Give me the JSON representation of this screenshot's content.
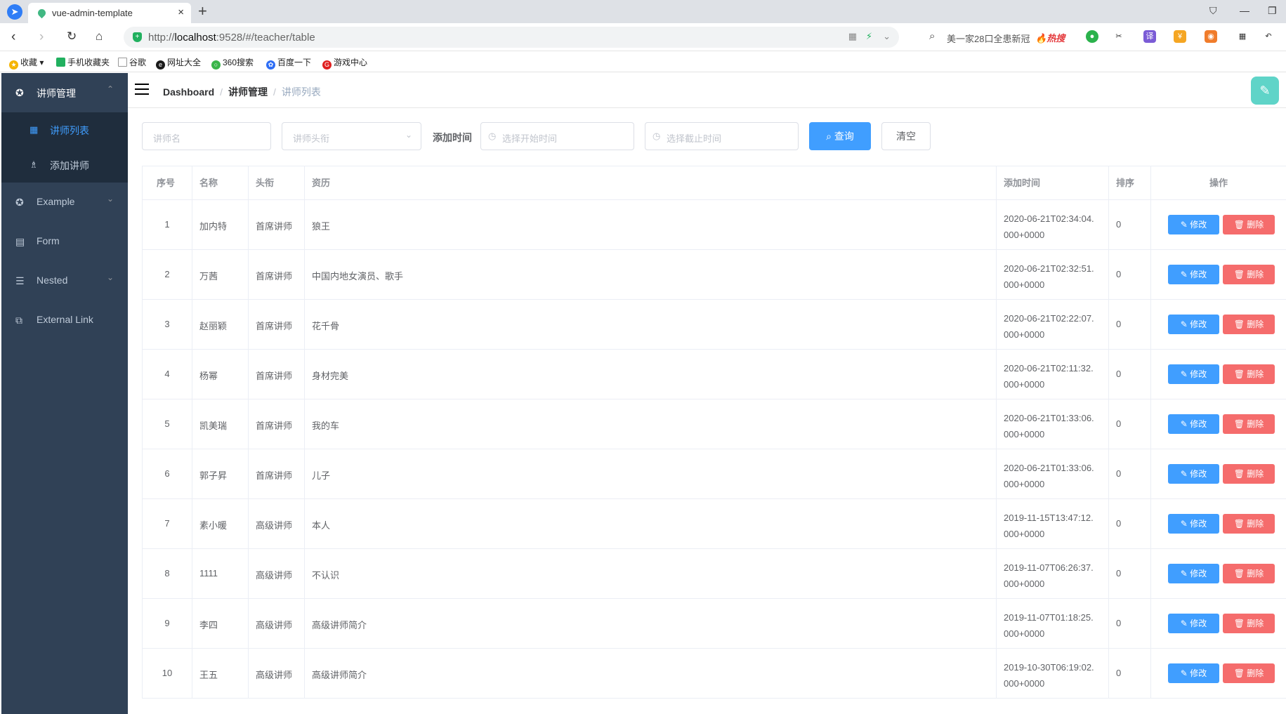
{
  "browser": {
    "tab_title": "vue-admin-template",
    "url_prefix": "http://",
    "url_host": "localhost",
    "url_rest": ":9528/#/teacher/table",
    "search_text": "美一家28口全患新冠",
    "hot_label": "热搜",
    "bookmarks": [
      "收藏",
      "手机收藏夹",
      "谷歌",
      "网址大全",
      "360搜索",
      "百度一下",
      "游戏中心"
    ]
  },
  "sidebar": {
    "group_label": "讲师管理",
    "sub_items": [
      "讲师列表",
      "添加讲师"
    ],
    "items": [
      "Example",
      "Form",
      "Nested",
      "External Link"
    ]
  },
  "navbar": {
    "breadcrumb": [
      "Dashboard",
      "讲师管理",
      "讲师列表"
    ]
  },
  "filter": {
    "name_placeholder": "讲师名",
    "level_placeholder": "讲师头衔",
    "time_label": "添加时间",
    "start_placeholder": "选择开始时间",
    "end_placeholder": "选择截止时间",
    "query_label": "查询",
    "clear_label": "清空"
  },
  "table": {
    "headers": [
      "序号",
      "名称",
      "头衔",
      "资历",
      "添加时间",
      "排序",
      "操作"
    ],
    "edit_label": "修改",
    "delete_label": "删除",
    "rows": [
      {
        "index": "1",
        "name": "加内特",
        "level": "首席讲师",
        "intro": "狼王",
        "time1": "2020-06-21T02:34:04.",
        "time2": "000+0000",
        "sort": "0"
      },
      {
        "index": "2",
        "name": "万茜",
        "level": "首席讲师",
        "intro": "中国内地女演员、歌手",
        "time1": "2020-06-21T02:32:51.",
        "time2": "000+0000",
        "sort": "0"
      },
      {
        "index": "3",
        "name": "赵丽颖",
        "level": "首席讲师",
        "intro": "花千骨",
        "time1": "2020-06-21T02:22:07.",
        "time2": "000+0000",
        "sort": "0"
      },
      {
        "index": "4",
        "name": "杨幂",
        "level": "首席讲师",
        "intro": "身材完美",
        "time1": "2020-06-21T02:11:32.",
        "time2": "000+0000",
        "sort": "0"
      },
      {
        "index": "5",
        "name": "凯美瑞",
        "level": "首席讲师",
        "intro": "我的车",
        "time1": "2020-06-21T01:33:06.",
        "time2": "000+0000",
        "sort": "0"
      },
      {
        "index": "6",
        "name": "郭子昇",
        "level": "首席讲师",
        "intro": "儿子",
        "time1": "2020-06-21T01:33:06.",
        "time2": "000+0000",
        "sort": "0"
      },
      {
        "index": "7",
        "name": "素小暖",
        "level": "高级讲师",
        "intro": "本人",
        "time1": "2019-11-15T13:47:12.",
        "time2": "000+0000",
        "sort": "0"
      },
      {
        "index": "8",
        "name": "1111",
        "level": "高级讲师",
        "intro": "不认识",
        "time1": "2019-11-07T06:26:37.",
        "time2": "000+0000",
        "sort": "0"
      },
      {
        "index": "9",
        "name": "李四",
        "level": "高级讲师",
        "intro": "高级讲师简介",
        "time1": "2019-11-07T01:18:25.",
        "time2": "000+0000",
        "sort": "0"
      },
      {
        "index": "10",
        "name": "王五",
        "level": "高级讲师",
        "intro": "高级讲师简介",
        "time1": "2019-10-30T06:19:02.",
        "time2": "000+0000",
        "sort": "0"
      }
    ]
  }
}
